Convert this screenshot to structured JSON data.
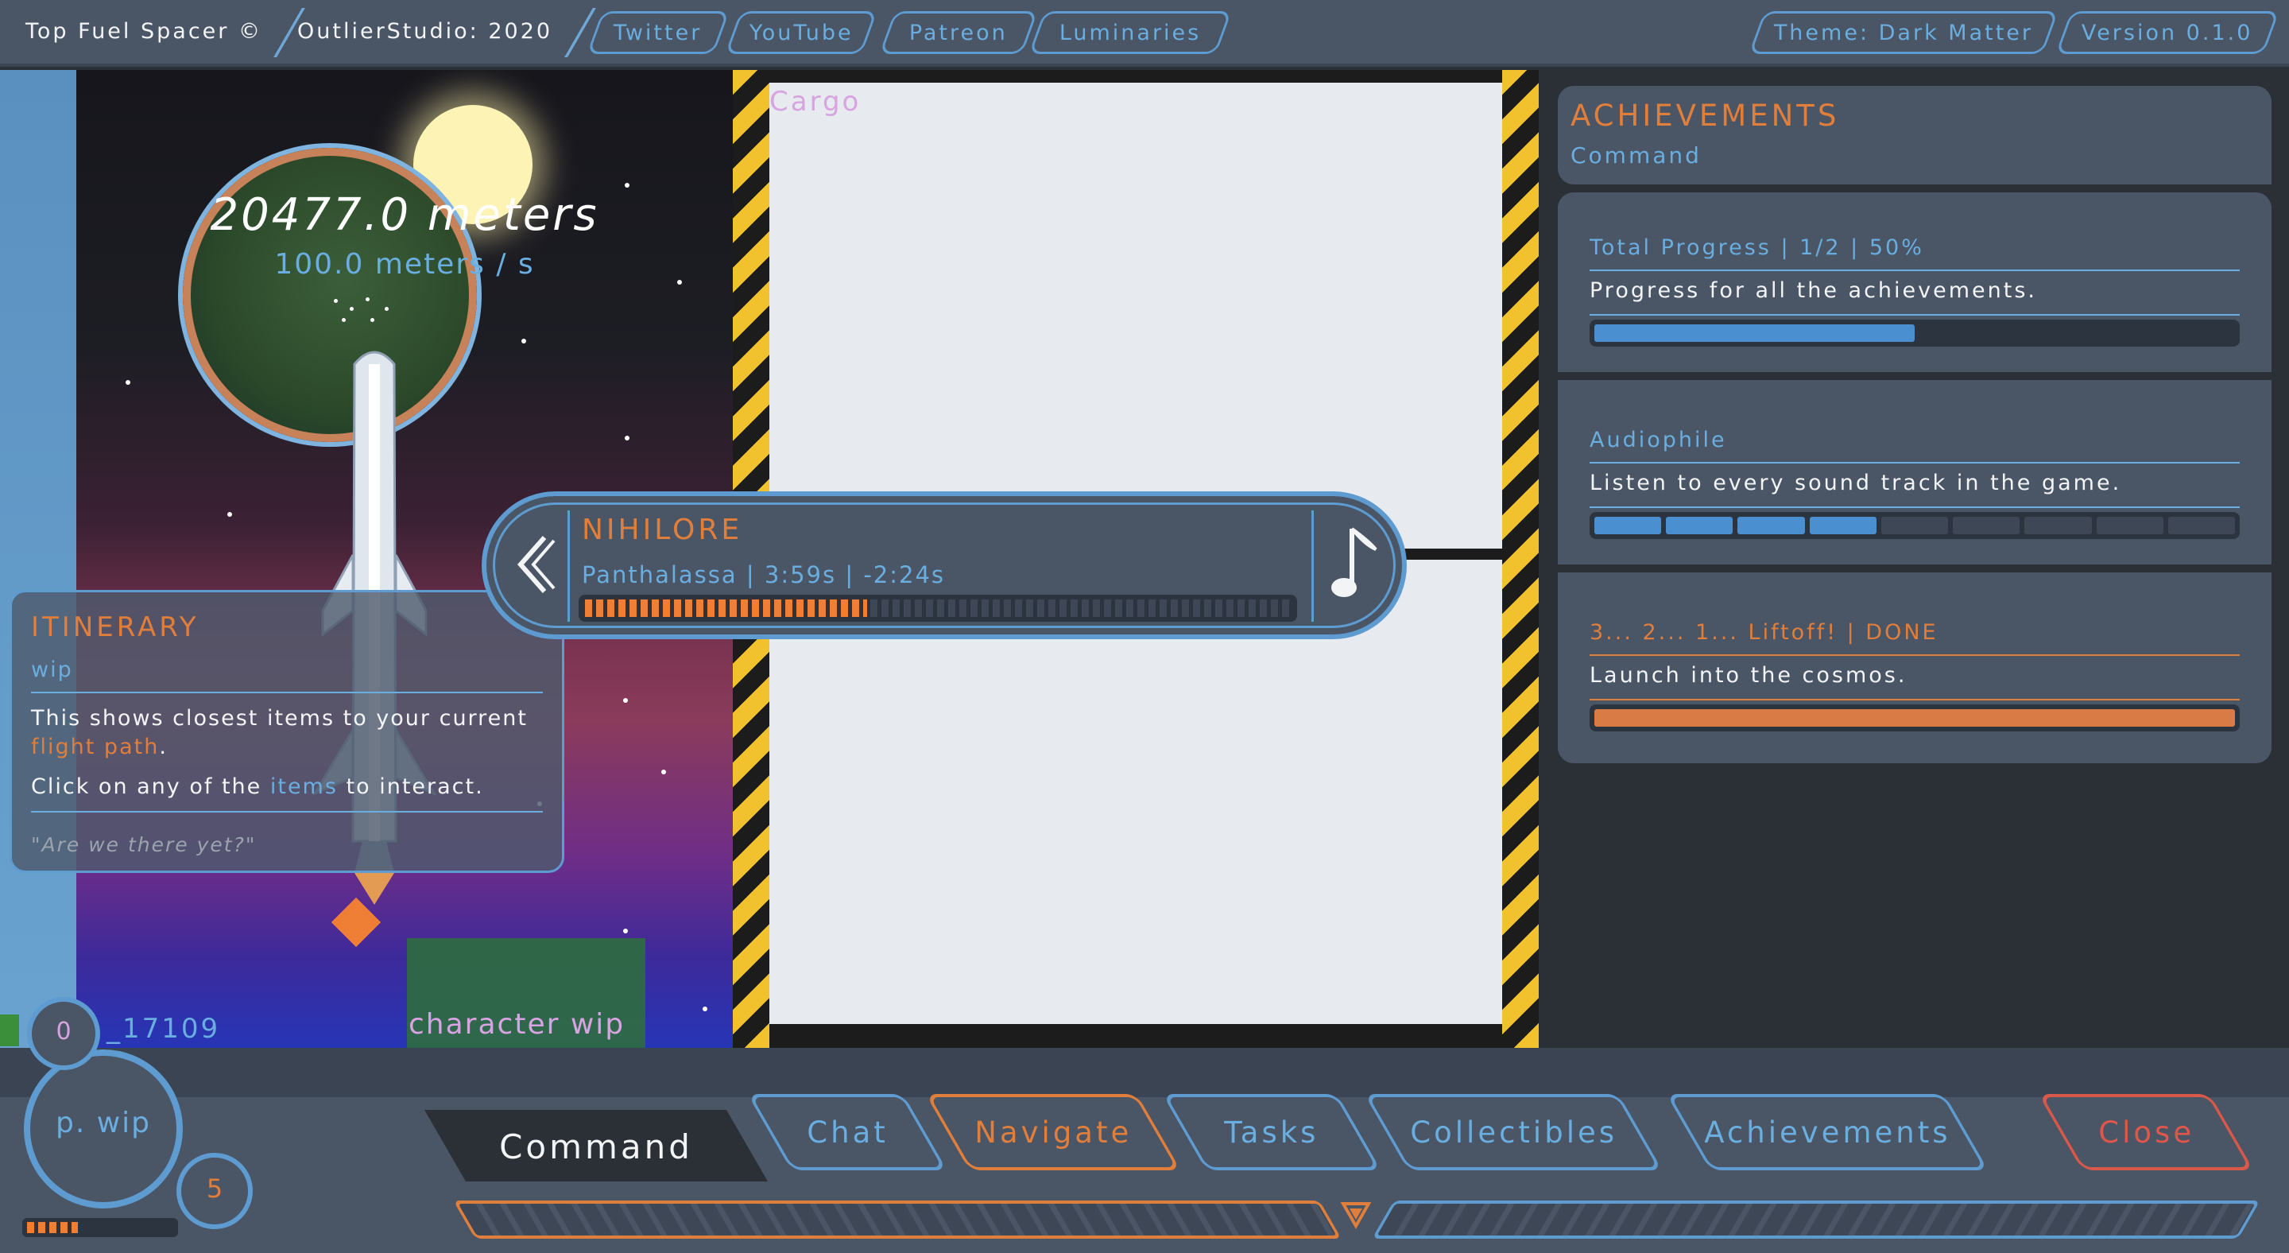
{
  "topbar": {
    "title": "Top Fuel Spacer ©",
    "studio": "OutlierStudio: 2020",
    "links": [
      "Twitter",
      "YouTube",
      "Patreon",
      "Luminaries"
    ],
    "theme": "Theme: Dark Matter",
    "version": "Version 0.1.0"
  },
  "scene": {
    "distance": "20477.0 meters",
    "speed": "100.0 meters / s",
    "character": "character wip"
  },
  "itinerary": {
    "title": "ITINERARY",
    "subtitle": "wip",
    "line1_a": "This shows closest items to your current ",
    "line1_b": "flight path",
    "line1_c": ".",
    "line2_a": "Click on any of the ",
    "line2_b": "items",
    "line2_c": " to interact.",
    "quote": "\"Are we there yet?\""
  },
  "cargo": {
    "label": "Cargo"
  },
  "player": {
    "track": "NIHILORE",
    "info": "Panthalassa | 3:59s | -2:24s",
    "progress": 0.4,
    "prev_icon": "chevron-left-icon",
    "music_icon": "music-note-icon"
  },
  "achievements": {
    "title": "ACHIEVEMENTS",
    "subtitle": "Command",
    "items": [
      {
        "title": "Total Progress | 1/2 | 50%",
        "desc": "Progress for all the achievements.",
        "progress": 0.5,
        "color": "#4a8fd0"
      },
      {
        "title": "Audiophile",
        "desc": "Listen to every sound track in the game.",
        "segments_filled": 4,
        "segments_total": 9,
        "color": "#4a8fd0"
      },
      {
        "title": "3... 2... 1... Liftoff! | DONE",
        "desc": "Launch into the cosmos.",
        "progress": 1.0,
        "color": "#d97b45"
      }
    ]
  },
  "bottom": {
    "command": "Command",
    "nav": [
      "Chat",
      "Navigate",
      "Tasks",
      "Collectibles",
      "Achievements"
    ],
    "close": "Close",
    "pilot": "p. wip",
    "counter": "0",
    "level": "5",
    "ship_id": "_17109"
  },
  "colors": {
    "accent_blue": "#5d9bd0",
    "accent_orange": "#e07e3c",
    "close_red": "#d8584a"
  }
}
